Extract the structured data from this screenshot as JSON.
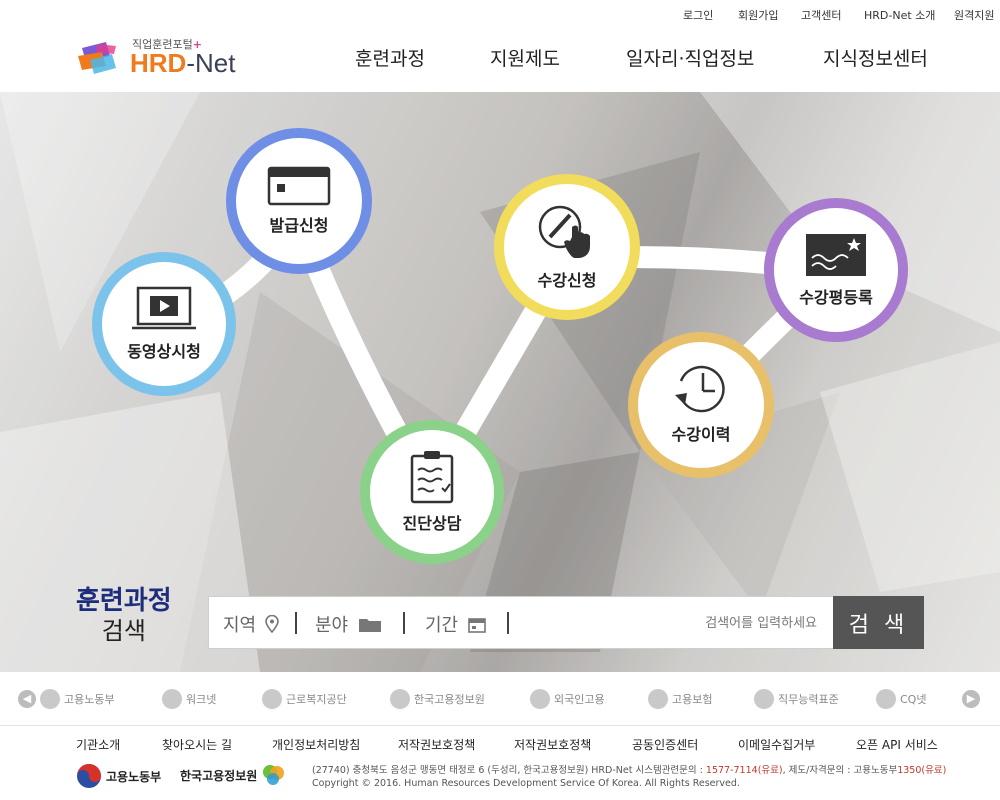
{
  "util_links": [
    "로그인",
    "회원가입",
    "고객센터",
    "HRD-Net 소개",
    "원격지원"
  ],
  "logo": {
    "subtitle": "직업훈련포털",
    "plus": "+",
    "brand": "HRD",
    "brand_suffix": "-Net"
  },
  "gnb": [
    "훈련과정",
    "지원제도",
    "일자리·직업정보",
    "지식정보센터"
  ],
  "hero": {
    "items": [
      {
        "label": "동영상시청",
        "icon": "video-icon",
        "color": "#7cc3ec"
      },
      {
        "label": "발급신청",
        "icon": "card-icon",
        "color": "#6f8fe6"
      },
      {
        "label": "진단상담",
        "icon": "checklist-icon",
        "color": "#8ad18a"
      },
      {
        "label": "수강신청",
        "icon": "touch-pen-icon",
        "color": "#f2dc5c"
      },
      {
        "label": "수강평등록",
        "icon": "review-star-icon",
        "color": "#a87bd0"
      },
      {
        "label": "수강이력",
        "icon": "history-clock-icon",
        "color": "#e8c06a"
      }
    ]
  },
  "search": {
    "title_line1": "훈련과정",
    "title_line2": "검색",
    "region_label": "지역",
    "field_label": "분야",
    "period_label": "기간",
    "placeholder": "검색어를 입력하세요",
    "button_label": "검 색"
  },
  "partners": [
    "고용노동부",
    "워크넷",
    "근로복지공단",
    "한국고용정보원",
    "외국인고용",
    "고용보험",
    "직무능력표준",
    "CQ넷"
  ],
  "footer": {
    "links": [
      "기관소개",
      "찾아오시는 길",
      "개인정보처리방침",
      "저작권보호정책",
      "저작권보호정책",
      "공동인증센터",
      "이메일수집거부",
      "오픈 API 서비스"
    ],
    "logos": [
      "고용노동부",
      "한국고용정보원"
    ],
    "address_prefix": "(27740) 충청북도 음성군 맹동면 태정로 6 (두성리, 한국고용정보원) HRD-Net 시스템관련문의 : ",
    "phone1": "1577-7114(유료)",
    "address_mid": ", 제도/자격문의 : 고용노동부",
    "phone2": "1350(유료)",
    "copyright": "Copyright © 2016. Human Resources Development Service Of Korea. All Rights Reserved."
  }
}
